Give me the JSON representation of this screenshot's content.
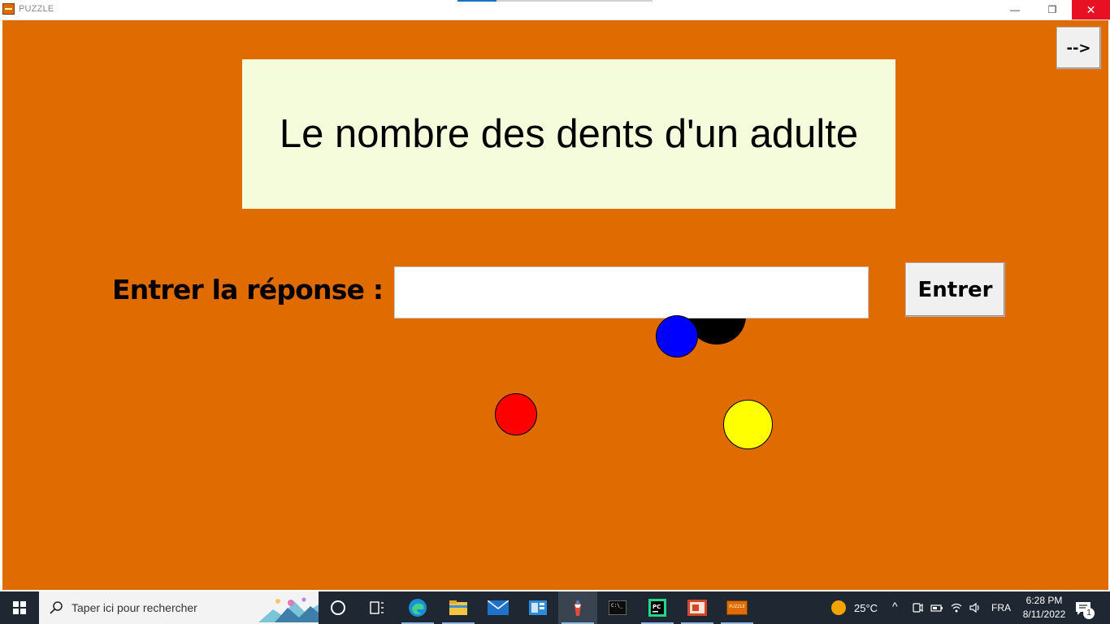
{
  "window": {
    "title": "PUZZLE",
    "icon": "puzzle-app-icon",
    "controls": {
      "minimize": "—",
      "maximize": "❐",
      "close": "✕"
    }
  },
  "game": {
    "next_label": "-->",
    "question": "Le nombre des dents d'un adulte",
    "answer_label": "Entrer la réponse :",
    "answer_value": "",
    "enter_label": "Entrer",
    "colors": {
      "background": "#e06b00",
      "question_box": "#f5fcdc",
      "balls": [
        "#000000",
        "#0000ff",
        "#ff0000",
        "#ffff00"
      ]
    }
  },
  "taskbar": {
    "search_placeholder": "Taper ici pour rechercher",
    "pinned": [
      "start-icon",
      "cortana-icon",
      "task-view-icon",
      "edge-icon",
      "file-explorer-icon",
      "mail-icon",
      "app-icon",
      "paint-icon",
      "terminal-icon",
      "pycharm-icon",
      "powerpoint-icon",
      "puzzle-icon"
    ],
    "puzzle_label": "PUZZLE",
    "tray": {
      "temperature": "25°C",
      "chevron": "^",
      "language": "FRA",
      "time": "6:28 PM",
      "date": "8/11/2022",
      "notifications": "1"
    }
  }
}
